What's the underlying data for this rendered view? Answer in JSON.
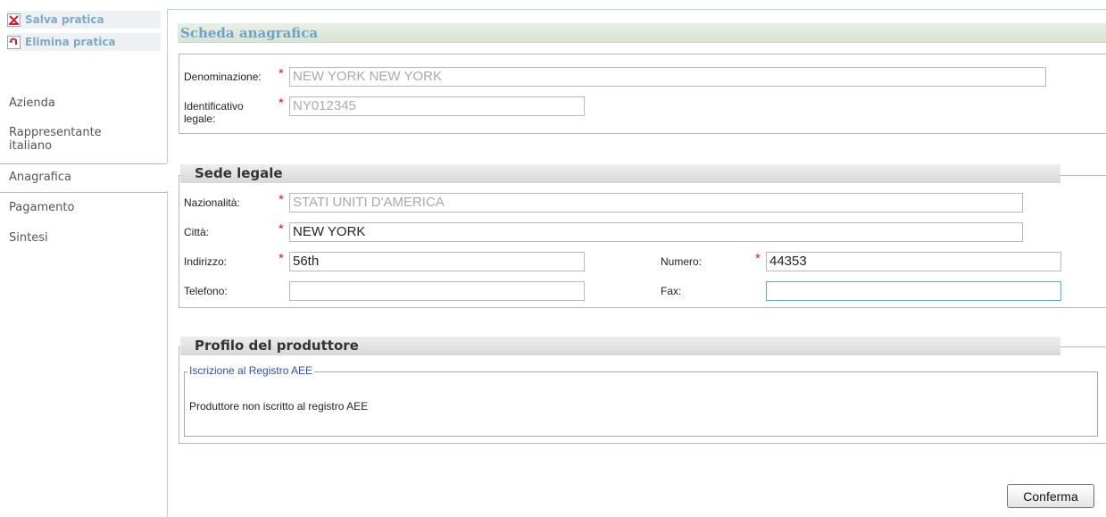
{
  "sidebar": {
    "actions": [
      {
        "label": "Salva pratica",
        "icon": "save-icon"
      },
      {
        "label": "Elimina pratica",
        "icon": "delete-icon"
      }
    ],
    "items": [
      {
        "label": "Azienda"
      },
      {
        "label": "Rappresentante italiano"
      },
      {
        "label": "Anagrafica",
        "active": true
      },
      {
        "label": "Pagamento"
      },
      {
        "label": "Sintesi"
      }
    ]
  },
  "header": {
    "title": "Scheda anagrafica"
  },
  "anagrafica": {
    "denominazione_label": "Denominazione:",
    "denominazione_value": "NEW YORK NEW YORK",
    "identificativo_label": "Identificativo legale:",
    "identificativo_value": "NY012345"
  },
  "sede_legale": {
    "title": "Sede legale",
    "nazionalita_label": "Nazionalità:",
    "nazionalita_value": "STATI UNITI D'AMERICA",
    "citta_label": "Città:",
    "citta_value": "NEW YORK",
    "indirizzo_label": "Indirizzo:",
    "indirizzo_value": "56th",
    "numero_label": "Numero:",
    "numero_value": "44353",
    "telefono_label": "Telefono:",
    "telefono_value": "",
    "fax_label": "Fax:",
    "fax_value": ""
  },
  "profilo": {
    "title": "Profilo del produttore",
    "registro_legend": "Iscrizione al Registro AEE",
    "registro_text": "Produttore non iscritto al registro AEE"
  },
  "required_mark": "*",
  "confirm_label": "Conferma",
  "colors": {
    "accent": "#6fa3c2",
    "required": "#d41e1e",
    "legend_link": "#2c4fb9"
  }
}
